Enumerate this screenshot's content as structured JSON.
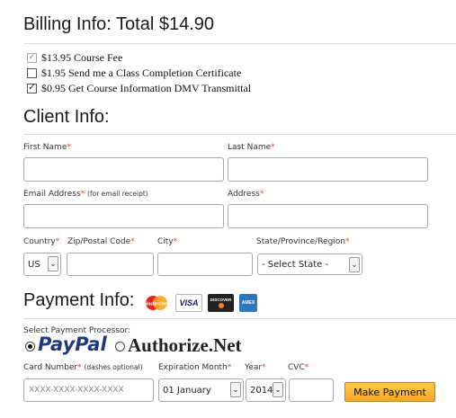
{
  "billing": {
    "title": "Billing Info: Total $14.90",
    "items": [
      {
        "label": "$13.95 Course Fee",
        "checked": true,
        "disabled": true
      },
      {
        "label": "$1.95 Send me a Class Completion Certificate",
        "checked": false,
        "disabled": false
      },
      {
        "label": "$0.95 Get Course Information DMV Transmittal",
        "checked": true,
        "disabled": false
      }
    ]
  },
  "client": {
    "title": "Client Info:",
    "required_mark": "*",
    "first_name_label": "First Name",
    "last_name_label": "Last Name",
    "email_label": "Email Address",
    "email_note": "(for email receipt)",
    "address_label": "Address",
    "country_label": "Country",
    "country_value": "US",
    "zip_label": "Zip/Postal Code",
    "city_label": "City",
    "state_label": "State/Province/Region",
    "state_value": "- Select State -"
  },
  "payment": {
    "title": "Payment Info:",
    "cards": [
      {
        "name": "mastercard-icon",
        "text": "MasterCard"
      },
      {
        "name": "visa-icon",
        "text": "VISA"
      },
      {
        "name": "discover-icon",
        "text": "DISCOVER"
      },
      {
        "name": "amex-icon",
        "text": "AMEX"
      }
    ],
    "processor_label": "Select Payment Processor:",
    "paypal_label": "PayPal",
    "authorize_label": "Authorize.Net",
    "card_number_label": "Card Number",
    "card_number_note": "(dashes optional)",
    "card_number_placeholder": "XXXX-XXXX-XXXX-XXXX",
    "exp_month_label": "Expiration Month",
    "exp_month_value": "01 January",
    "year_label": "Year",
    "year_value": "2014",
    "cvc_label": "CVC",
    "submit_label": "Make Payment"
  },
  "colors": {
    "required": "#e23b2e",
    "paypal_dark": "#1f3a7a",
    "paypal_light": "#2c8ed6",
    "button": "#f5a623"
  }
}
